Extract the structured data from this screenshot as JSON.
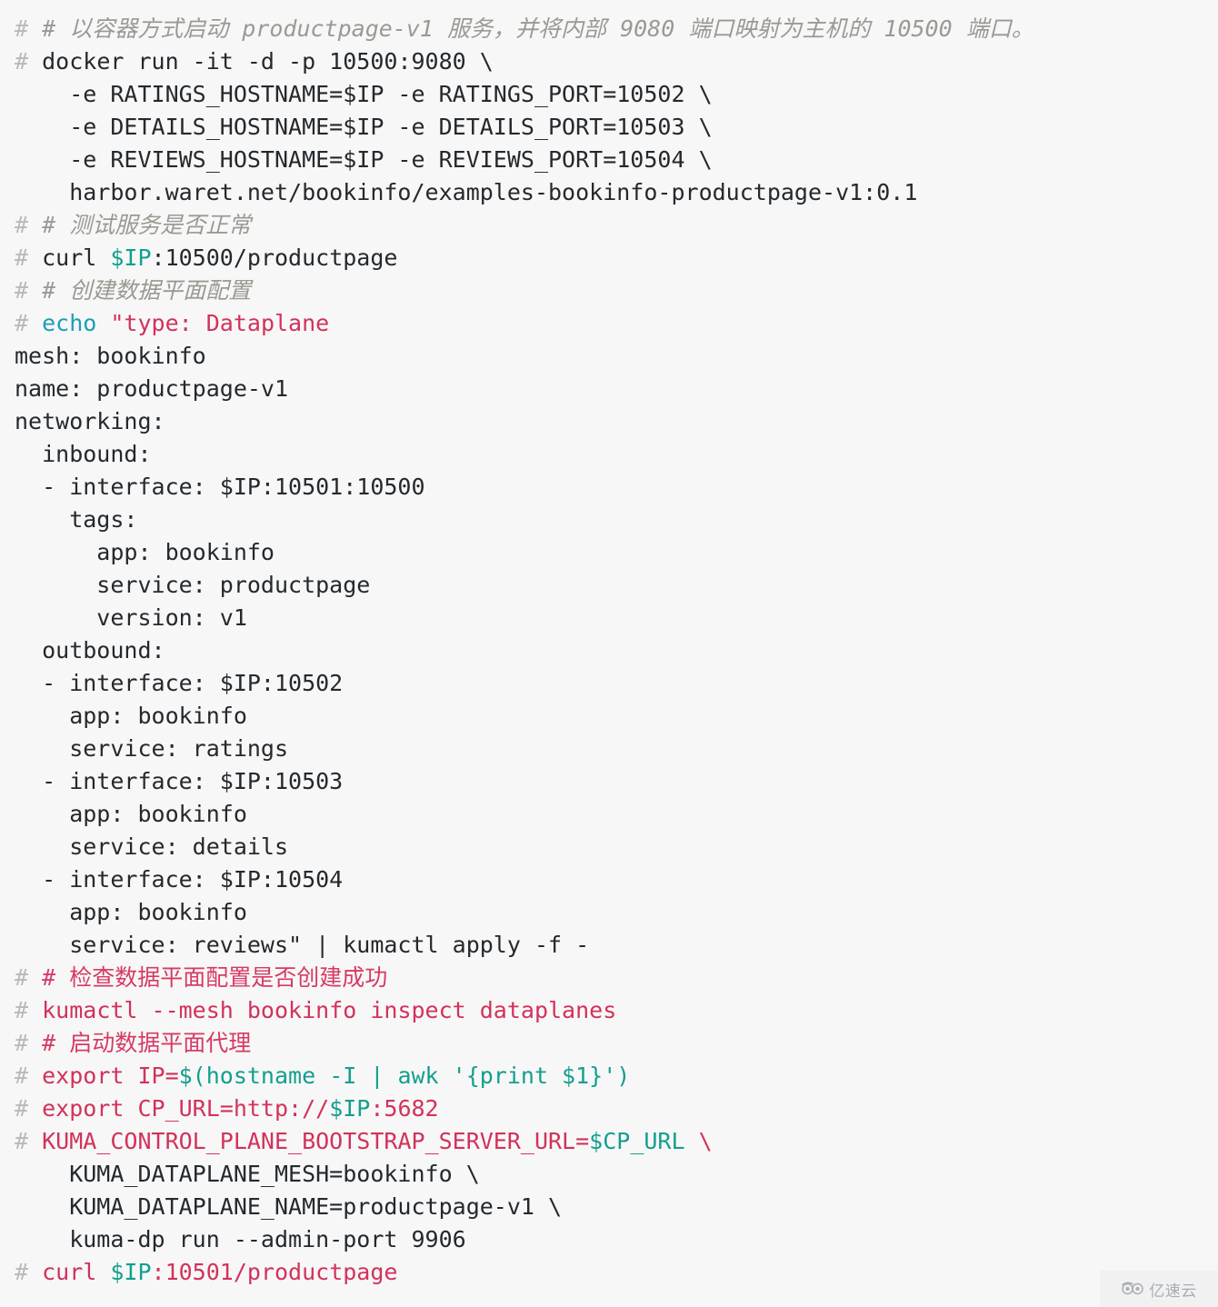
{
  "document": {
    "kind": "code-block",
    "language": "shell",
    "background_color": "#f7f7f7",
    "colors": {
      "prompt": "#b9b9b9",
      "comment_gray": "#9a9a93",
      "comment_red": "#d63b63",
      "plain_text": "#24292e",
      "keyword_teal": "#1a9fb5",
      "string_crimson": "#d2325a",
      "variable_teal": "#139f8e",
      "command_crimson": "#d2325a"
    }
  },
  "code_lines": [
    {
      "id": "l1",
      "tokens": [
        {
          "text": "# ",
          "style": "prompt"
        },
        {
          "text": "# 以容器方式启动 productpage-v1 服务，并将内部 9080 端口映射为主机的 10500 端口。",
          "style": "comment"
        }
      ]
    },
    {
      "id": "l2",
      "tokens": [
        {
          "text": "# ",
          "style": "prompt"
        },
        {
          "text": "docker run -it -d -p 10500:9080 \\",
          "style": "plain"
        }
      ]
    },
    {
      "id": "l3",
      "tokens": [
        {
          "text": "    -e RATINGS_HOSTNAME=$IP -e RATINGS_PORT=10502 \\",
          "style": "plain"
        }
      ]
    },
    {
      "id": "l4",
      "tokens": [
        {
          "text": "    -e DETAILS_HOSTNAME=$IP -e DETAILS_PORT=10503 \\",
          "style": "plain"
        }
      ]
    },
    {
      "id": "l5",
      "tokens": [
        {
          "text": "    -e REVIEWS_HOSTNAME=$IP -e REVIEWS_PORT=10504 \\",
          "style": "plain"
        }
      ]
    },
    {
      "id": "l6",
      "tokens": [
        {
          "text": "    harbor.waret.net/bookinfo/examples-bookinfo-productpage-v1:0.1",
          "style": "plain"
        }
      ]
    },
    {
      "id": "l7",
      "tokens": [
        {
          "text": "# ",
          "style": "prompt"
        },
        {
          "text": "# 测试服务是否正常",
          "style": "comment"
        }
      ]
    },
    {
      "id": "l8",
      "tokens": [
        {
          "text": "# ",
          "style": "prompt"
        },
        {
          "text": "curl ",
          "style": "plain"
        },
        {
          "text": "$IP",
          "style": "variable"
        },
        {
          "text": ":10500/productpage",
          "style": "plain"
        }
      ]
    },
    {
      "id": "l9",
      "tokens": [
        {
          "text": "# ",
          "style": "prompt"
        },
        {
          "text": "# 创建数据平面配置",
          "style": "comment"
        }
      ]
    },
    {
      "id": "l10",
      "tokens": [
        {
          "text": "# ",
          "style": "prompt"
        },
        {
          "text": "echo ",
          "style": "keyword"
        },
        {
          "text": "\"type: Dataplane",
          "style": "string"
        }
      ]
    },
    {
      "id": "l11",
      "tokens": [
        {
          "text": "mesh: bookinfo",
          "style": "plain"
        }
      ]
    },
    {
      "id": "l12",
      "tokens": [
        {
          "text": "name: productpage-v1",
          "style": "plain"
        }
      ]
    },
    {
      "id": "l13",
      "tokens": [
        {
          "text": "networking:",
          "style": "plain"
        }
      ]
    },
    {
      "id": "l14",
      "tokens": [
        {
          "text": "  inbound:",
          "style": "plain"
        }
      ]
    },
    {
      "id": "l15",
      "tokens": [
        {
          "text": "  - interface: $IP:10501:10500",
          "style": "plain"
        }
      ]
    },
    {
      "id": "l16",
      "tokens": [
        {
          "text": "    tags:",
          "style": "plain"
        }
      ]
    },
    {
      "id": "l17",
      "tokens": [
        {
          "text": "      app: bookinfo",
          "style": "plain"
        }
      ]
    },
    {
      "id": "l18",
      "tokens": [
        {
          "text": "      service: productpage",
          "style": "plain"
        }
      ]
    },
    {
      "id": "l19",
      "tokens": [
        {
          "text": "      version: v1",
          "style": "plain"
        }
      ]
    },
    {
      "id": "l20",
      "tokens": [
        {
          "text": "  outbound:",
          "style": "plain"
        }
      ]
    },
    {
      "id": "l21",
      "tokens": [
        {
          "text": "  - interface: $IP:10502",
          "style": "plain"
        }
      ]
    },
    {
      "id": "l22",
      "tokens": [
        {
          "text": "    app: bookinfo",
          "style": "plain"
        }
      ]
    },
    {
      "id": "l23",
      "tokens": [
        {
          "text": "    service: ratings",
          "style": "plain"
        }
      ]
    },
    {
      "id": "l24",
      "tokens": [
        {
          "text": "  - interface: $IP:10503",
          "style": "plain"
        }
      ]
    },
    {
      "id": "l25",
      "tokens": [
        {
          "text": "    app: bookinfo",
          "style": "plain"
        }
      ]
    },
    {
      "id": "l26",
      "tokens": [
        {
          "text": "    service: details",
          "style": "plain"
        }
      ]
    },
    {
      "id": "l27",
      "tokens": [
        {
          "text": "  - interface: $IP:10504",
          "style": "plain"
        }
      ]
    },
    {
      "id": "l28",
      "tokens": [
        {
          "text": "    app: bookinfo",
          "style": "plain"
        }
      ]
    },
    {
      "id": "l29",
      "tokens": [
        {
          "text": "    service: reviews\" | kumactl apply -f -",
          "style": "plain"
        }
      ]
    },
    {
      "id": "l30",
      "tokens": [
        {
          "text": "# ",
          "style": "prompt"
        },
        {
          "text": "# 检查数据平面配置是否创建成功",
          "style": "comment-red"
        }
      ]
    },
    {
      "id": "l31",
      "tokens": [
        {
          "text": "# ",
          "style": "prompt"
        },
        {
          "text": "kumactl --mesh bookinfo inspect dataplanes",
          "style": "command"
        }
      ]
    },
    {
      "id": "l32",
      "tokens": [
        {
          "text": "# ",
          "style": "prompt"
        },
        {
          "text": "# 启动数据平面代理",
          "style": "comment-red"
        }
      ]
    },
    {
      "id": "l33",
      "tokens": [
        {
          "text": "# ",
          "style": "prompt"
        },
        {
          "text": "export IP=",
          "style": "command"
        },
        {
          "text": "$(hostname -I | awk '{print $1}')",
          "style": "variable"
        }
      ]
    },
    {
      "id": "l34",
      "tokens": [
        {
          "text": "# ",
          "style": "prompt"
        },
        {
          "text": "export CP_URL=http://",
          "style": "command"
        },
        {
          "text": "$IP",
          "style": "variable"
        },
        {
          "text": ":5682",
          "style": "command"
        }
      ]
    },
    {
      "id": "l35",
      "tokens": [
        {
          "text": "# ",
          "style": "prompt"
        },
        {
          "text": "KUMA_CONTROL_PLANE_BOOTSTRAP_SERVER_URL=",
          "style": "command"
        },
        {
          "text": "$CP_URL",
          "style": "variable"
        },
        {
          "text": " \\",
          "style": "command"
        }
      ]
    },
    {
      "id": "l36",
      "tokens": [
        {
          "text": "    KUMA_DATAPLANE_MESH=bookinfo \\",
          "style": "plain"
        }
      ]
    },
    {
      "id": "l37",
      "tokens": [
        {
          "text": "    KUMA_DATAPLANE_NAME=productpage-v1 \\",
          "style": "plain"
        }
      ]
    },
    {
      "id": "l38",
      "tokens": [
        {
          "text": "    kuma-dp run --admin-port 9906",
          "style": "plain"
        }
      ]
    },
    {
      "id": "l39",
      "tokens": [
        {
          "text": "# ",
          "style": "prompt"
        },
        {
          "text": "curl ",
          "style": "command"
        },
        {
          "text": "$IP",
          "style": "variable"
        },
        {
          "text": ":10501/productpage",
          "style": "command"
        }
      ]
    }
  ],
  "watermark": {
    "icon": "cloud-logo-icon",
    "text": "亿速云"
  }
}
